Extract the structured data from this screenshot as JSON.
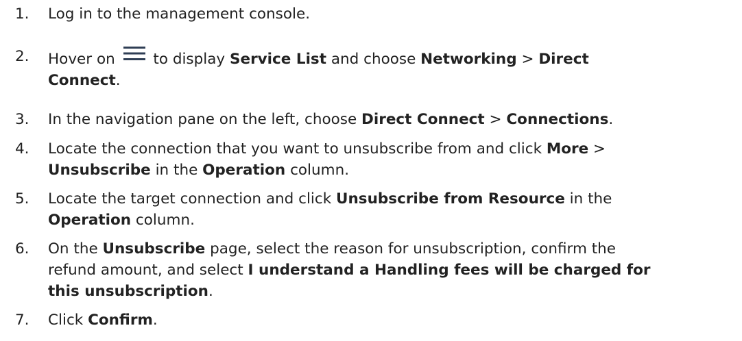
{
  "steps": [
    {
      "number": "1.",
      "parts": [
        {
          "t": "Log in to the management console.",
          "b": false
        }
      ]
    },
    {
      "number": "2.",
      "parts": [
        {
          "t": "Hover on ",
          "b": false
        },
        {
          "icon": "menu-icon"
        },
        {
          "t": " to display ",
          "b": false
        },
        {
          "t": "Service List",
          "b": true
        },
        {
          "t": " and choose ",
          "b": false
        },
        {
          "t": "Networking",
          "b": true
        },
        {
          "t": " > ",
          "b": false
        },
        {
          "t": "Direct",
          "b": true
        },
        {
          "br": true
        },
        {
          "t": "Connect",
          "b": true
        },
        {
          "t": ".",
          "b": false
        }
      ]
    },
    {
      "number": "3.",
      "parts": [
        {
          "t": "In the navigation pane on the left, choose ",
          "b": false
        },
        {
          "t": "Direct Connect",
          "b": true
        },
        {
          "t": " > ",
          "b": false
        },
        {
          "t": "Connections",
          "b": true
        },
        {
          "t": ".",
          "b": false
        }
      ]
    },
    {
      "number": "4.",
      "parts": [
        {
          "t": "Locate the connection that you want to unsubscribe from and click ",
          "b": false
        },
        {
          "t": "More",
          "b": true
        },
        {
          "t": " >",
          "b": false
        },
        {
          "br": true
        },
        {
          "t": "Unsubscribe",
          "b": true
        },
        {
          "t": " in the ",
          "b": false
        },
        {
          "t": "Operation",
          "b": true
        },
        {
          "t": " column.",
          "b": false
        }
      ]
    },
    {
      "number": "5.",
      "parts": [
        {
          "t": "Locate the target connection and click ",
          "b": false
        },
        {
          "t": "Unsubscribe from Resource",
          "b": true
        },
        {
          "t": " in the",
          "b": false
        },
        {
          "br": true
        },
        {
          "t": "Operation",
          "b": true
        },
        {
          "t": " column.",
          "b": false
        }
      ]
    },
    {
      "number": "6.",
      "parts": [
        {
          "t": "On the ",
          "b": false
        },
        {
          "t": "Unsubscribe",
          "b": true
        },
        {
          "t": " page, select the reason for unsubscription, confirm the",
          "b": false
        },
        {
          "br": true
        },
        {
          "t": "refund amount, and select ",
          "b": false
        },
        {
          "t": "I understand a Handling fees will be charged for",
          "b": true
        },
        {
          "br": true
        },
        {
          "t": "this unsubscription",
          "b": true
        },
        {
          "t": ".",
          "b": false
        }
      ]
    },
    {
      "number": "7.",
      "parts": [
        {
          "t": "Click ",
          "b": false
        },
        {
          "t": "Confirm",
          "b": true
        },
        {
          "t": ".",
          "b": false
        }
      ]
    }
  ]
}
